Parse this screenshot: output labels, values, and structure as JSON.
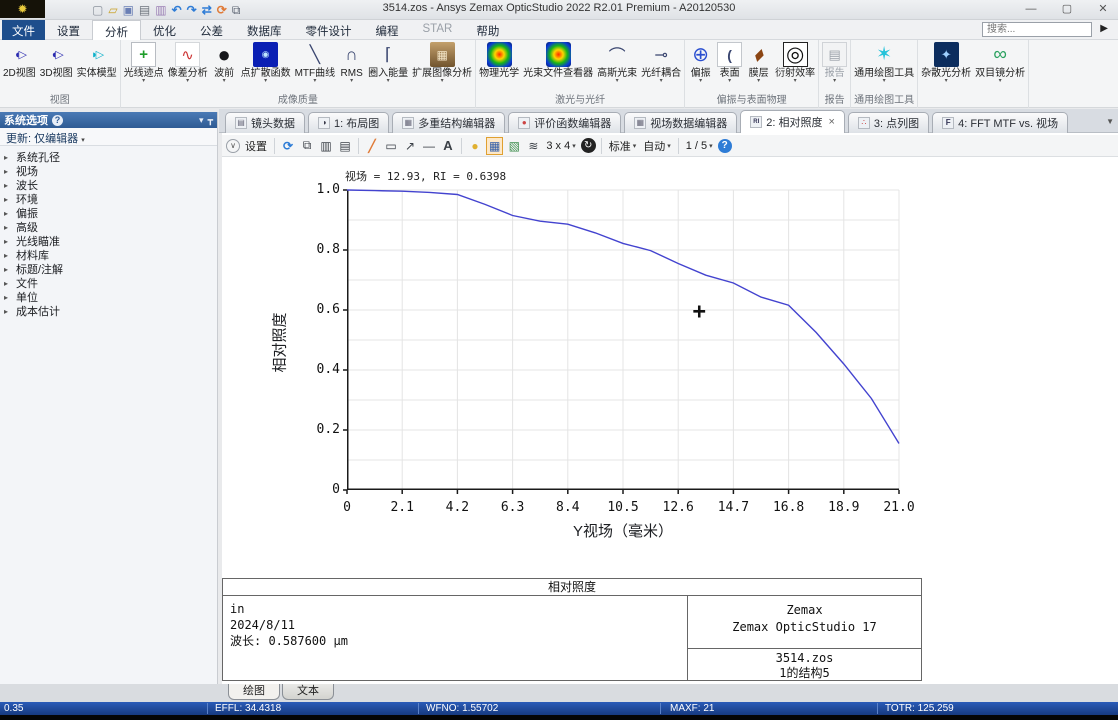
{
  "titlebar": {
    "title": "3514.zos - Ansys Zemax OpticStudio 2022 R2.01  Premium - A20120530",
    "quick_icons": [
      "new-file",
      "open-file",
      "save",
      "print",
      "save-image",
      "undo",
      "redo",
      "sync",
      "refresh",
      "window-layout"
    ],
    "search_placeholder": "搜索..."
  },
  "menu_tabs": [
    {
      "label": "文件",
      "style": "file"
    },
    {
      "label": "设置"
    },
    {
      "label": "分析",
      "active": true
    },
    {
      "label": "优化"
    },
    {
      "label": "公差"
    },
    {
      "label": "数据库"
    },
    {
      "label": "零件设计"
    },
    {
      "label": "编程"
    },
    {
      "label": "STAR",
      "disabled": true
    },
    {
      "label": "帮助"
    }
  ],
  "ribbon": {
    "groups": [
      {
        "label": "视图",
        "items": [
          {
            "label": "2D视图",
            "icon": "lens-2d"
          },
          {
            "label": "3D视图",
            "icon": "lens-3d"
          },
          {
            "label": "实体模型",
            "icon": "solid-model"
          }
        ]
      },
      {
        "label": "成像质量",
        "items": [
          {
            "label": "光线迹点",
            "icon": "ray-trace",
            "arrow": true
          },
          {
            "label": "像差分析",
            "icon": "aberration",
            "arrow": true
          },
          {
            "label": "波前",
            "icon": "wavefront",
            "arrow": true
          },
          {
            "label": "点扩散函数",
            "icon": "psf",
            "arrow": true
          },
          {
            "label": "MTF曲线",
            "icon": "mtf-curve",
            "arrow": true
          },
          {
            "label": "RMS",
            "icon": "rms",
            "arrow": true
          },
          {
            "label": "圈入能量",
            "icon": "enclosed-energy",
            "arrow": true
          },
          {
            "label": "扩展图像分析",
            "icon": "extended-image",
            "arrow": true
          }
        ]
      },
      {
        "label": "激光与光纤",
        "items": [
          {
            "label": "物理光学",
            "icon": "physical-optics"
          },
          {
            "label": "光束文件查看器",
            "icon": "beam-file-viewer"
          },
          {
            "label": "高斯光束",
            "icon": "gaussian-beam",
            "arrow": true
          },
          {
            "label": "光纤耦合",
            "icon": "fiber-coupling",
            "arrow": true
          }
        ]
      },
      {
        "label": "偏振与表面物理",
        "items": [
          {
            "label": "偏振",
            "icon": "polarization",
            "arrow": true
          },
          {
            "label": "表面",
            "icon": "surface",
            "arrow": true
          },
          {
            "label": "膜层",
            "icon": "coating",
            "arrow": true
          },
          {
            "label": "衍射效率",
            "icon": "diffraction-efficiency",
            "arrow": true
          }
        ]
      },
      {
        "label": "报告",
        "items": [
          {
            "label": "报告",
            "icon": "report",
            "arrow": true
          }
        ]
      },
      {
        "label": "通用绘图工具",
        "items": [
          {
            "label": "通用绘图工具",
            "icon": "universal-plot",
            "arrow": true
          }
        ]
      },
      {
        "label": "",
        "items": [
          {
            "label": "杂散光分析",
            "icon": "stray-light",
            "arrow": true
          },
          {
            "label": "双目镜分析",
            "icon": "binocular",
            "arrow": true
          }
        ]
      }
    ]
  },
  "sidebar": {
    "title": "系统选项",
    "update_prefix": "更新:",
    "update_value": "仅编辑器",
    "items": [
      "系统孔径",
      "视场",
      "波长",
      "环境",
      "偏振",
      "高级",
      "光线瞄准",
      "材料库",
      "标题/注解",
      "文件",
      "单位",
      "成本估计"
    ]
  },
  "doc_tabs": [
    {
      "icon": "lens-data",
      "label": "镜头数据"
    },
    {
      "icon": "layout",
      "label": "1: 布局图"
    },
    {
      "icon": "multi-config",
      "label": "多重结构编辑器"
    },
    {
      "icon": "merit",
      "label": "评价函数编辑器"
    },
    {
      "icon": "field-data",
      "label": "视场数据编辑器"
    },
    {
      "icon": "relative-illum",
      "label": "2: 相对照度",
      "active": true,
      "closable": true
    },
    {
      "icon": "spot",
      "label": "3: 点列图"
    },
    {
      "icon": "fft",
      "label": "4: FFT MTF vs. 视场"
    }
  ],
  "chart_toolbar": {
    "items": [
      {
        "type": "icon",
        "name": "collapse-settings"
      },
      {
        "type": "text",
        "name": "settings-button",
        "label": "设置"
      },
      {
        "type": "sep"
      },
      {
        "type": "icon",
        "name": "refresh"
      },
      {
        "type": "icon",
        "name": "copy"
      },
      {
        "type": "icon",
        "name": "save-image"
      },
      {
        "type": "icon",
        "name": "print"
      },
      {
        "type": "sep"
      },
      {
        "type": "icon",
        "name": "draw-pencil"
      },
      {
        "type": "icon",
        "name": "draw-rectangle"
      },
      {
        "type": "icon",
        "name": "draw-arrow"
      },
      {
        "type": "icon",
        "name": "draw-line"
      },
      {
        "type": "icon",
        "name": "draw-text"
      },
      {
        "type": "sep"
      },
      {
        "type": "icon",
        "name": "highlight"
      },
      {
        "type": "icon",
        "name": "grid-layout",
        "active": true
      },
      {
        "type": "icon",
        "name": "slides"
      },
      {
        "type": "icon",
        "name": "layers"
      },
      {
        "type": "dropdown",
        "name": "grid-size",
        "label": "3 x 4",
        "dropdown": true
      },
      {
        "type": "icon",
        "name": "replay"
      },
      {
        "type": "sep"
      },
      {
        "type": "dropdown",
        "name": "standard-select",
        "label": "标准",
        "dropdown": true
      },
      {
        "type": "dropdown",
        "name": "auto-select",
        "label": "自动",
        "dropdown": true
      },
      {
        "type": "sep"
      },
      {
        "type": "dropdown",
        "name": "page-select",
        "label": "1 / 5",
        "dropdown": true
      },
      {
        "type": "icon",
        "name": "help"
      }
    ]
  },
  "chart_data": {
    "type": "line",
    "title": "视场 = 12.93, RI = 0.6398",
    "xlabel": "Y视场（毫米）",
    "ylabel": "相对照度",
    "xlim": [
      0,
      21
    ],
    "ylim": [
      0,
      1
    ],
    "xticks": [
      "0",
      "2.1",
      "4.2",
      "6.3",
      "8.4",
      "10.5",
      "12.6",
      "14.7",
      "16.8",
      "18.9",
      "21.0"
    ],
    "yticks": [
      "0",
      "0.2",
      "0.4",
      "0.6",
      "0.8",
      "1.0"
    ],
    "grid": true,
    "grid_x_step": 2.1,
    "grid_y_step": 0.1,
    "legend_position": "none",
    "line_color": "#4343cf",
    "series": [
      {
        "name": "相对照度",
        "x": [
          0,
          1.05,
          2.1,
          3.15,
          4.2,
          5.25,
          6.3,
          7.35,
          8.4,
          9.45,
          10.5,
          11.55,
          12.6,
          13.65,
          14.7,
          15.75,
          16.8,
          17.85,
          18.9,
          19.95,
          21.0
        ],
        "y": [
          1.0,
          0.998,
          0.996,
          0.992,
          0.985,
          0.952,
          0.915,
          0.896,
          0.886,
          0.857,
          0.822,
          0.798,
          0.755,
          0.716,
          0.69,
          0.643,
          0.616,
          0.525,
          0.42,
          0.305,
          0.155
        ]
      }
    ],
    "cursor": {
      "x": 13.4,
      "y": 0.59
    }
  },
  "info_table": {
    "header": "相对照度",
    "left_lines": [
      "in",
      "2024/8/11",
      "波长: 0.587600 µm"
    ],
    "right_top_lines": [
      "Zemax",
      "Zemax OpticStudio 17"
    ],
    "right_bottom_lines": [
      "3514.zos",
      "1的结构5"
    ]
  },
  "bottom_tabs": [
    {
      "label": "绘图",
      "active": true
    },
    {
      "label": "文本"
    }
  ],
  "status_bar": {
    "segments": [
      "0.35",
      "EFFL: 34.4318",
      "WFNO: 1.55702",
      "MAXF: 21",
      "TOTR: 125.259"
    ]
  },
  "colors": {
    "curve": "#4343cf",
    "status_bar_blue": "#1d4ea8",
    "file_tab_blue": "#1e4e8c"
  }
}
